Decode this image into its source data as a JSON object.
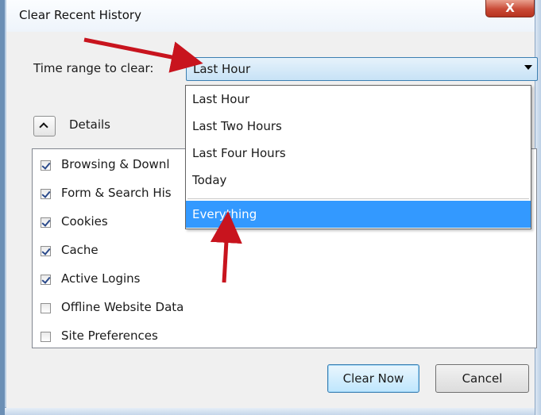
{
  "window": {
    "title": "Clear Recent History",
    "close_glyph": "X"
  },
  "time_range": {
    "label": "Time range to clear:",
    "selected": "Last Hour",
    "options": [
      "Last Hour",
      "Last Two Hours",
      "Last Four Hours",
      "Today",
      "Everything"
    ],
    "highlighted_option": "Everything"
  },
  "details": {
    "label": "Details",
    "expanded": true
  },
  "items": [
    {
      "label": "Browsing & Downl",
      "checked": true
    },
    {
      "label": "Form & Search His",
      "checked": true
    },
    {
      "label": "Cookies",
      "checked": true
    },
    {
      "label": "Cache",
      "checked": true
    },
    {
      "label": "Active Logins",
      "checked": true
    },
    {
      "label": "Offline Website Data",
      "checked": false
    },
    {
      "label": "Site Preferences",
      "checked": false
    }
  ],
  "buttons": {
    "clear_now": "Clear Now",
    "cancel": "Cancel"
  },
  "colors": {
    "accent_blue": "#3399ff",
    "annotation_arrow": "#c8141e"
  },
  "icons": {
    "close": "close-icon",
    "expand": "chevron-up-icon",
    "dropdown": "dropdown-arrow-icon"
  }
}
